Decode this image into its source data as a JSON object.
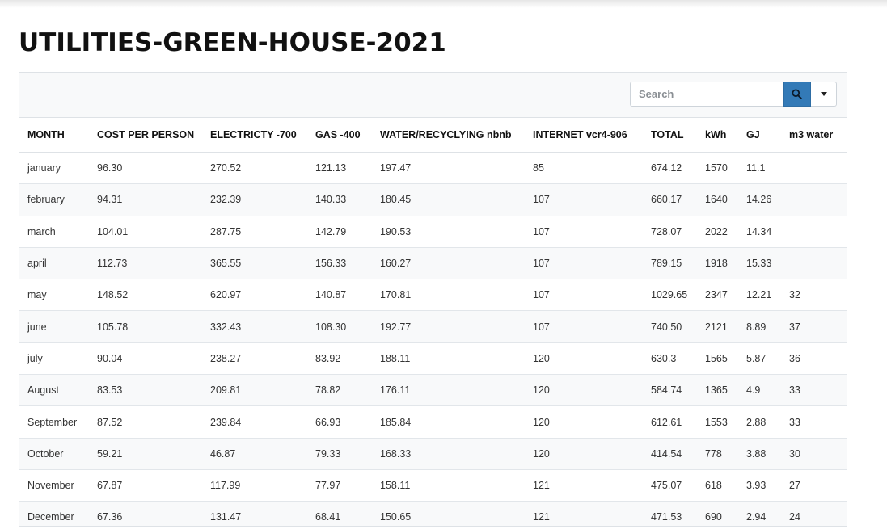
{
  "page": {
    "title": "UTILITIES-GREEN-HOUSE-2021"
  },
  "toolbar": {
    "search_placeholder": "Search"
  },
  "icons": {
    "search": "search-icon",
    "dropdown": "caret-down-icon"
  },
  "colors": {
    "search_button": "#337ab7",
    "row_stripe": "#f8f9fa",
    "border": "#dee2e6"
  },
  "table": {
    "headers": [
      "MONTH",
      "COST PER PERSON",
      "ELECTRICTY -700",
      "GAS -400",
      "WATER/RECYCLYING nbnb",
      "INTERNET vcr4-906",
      "TOTAL",
      "kWh",
      "GJ",
      "m3 water"
    ],
    "rows": [
      [
        "january",
        "96.30",
        "270.52",
        "121.13",
        "197.47",
        "85",
        "674.12",
        "1570",
        "11.1",
        ""
      ],
      [
        "february",
        "94.31",
        "232.39",
        "140.33",
        "180.45",
        "107",
        "660.17",
        "1640",
        "14.26",
        ""
      ],
      [
        "march",
        "104.01",
        "287.75",
        "142.79",
        "190.53",
        "107",
        "728.07",
        "2022",
        "14.34",
        ""
      ],
      [
        "april",
        "112.73",
        "365.55",
        "156.33",
        "160.27",
        "107",
        "789.15",
        "1918",
        "15.33",
        ""
      ],
      [
        "may",
        "148.52",
        "620.97",
        "140.87",
        "170.81",
        "107",
        "1029.65",
        "2347",
        "12.21",
        "32"
      ],
      [
        "june",
        "105.78",
        "332.43",
        "108.30",
        "192.77",
        "107",
        "740.50",
        "2121",
        "8.89",
        "37"
      ],
      [
        "july",
        "90.04",
        "238.27",
        "83.92",
        "188.11",
        "120",
        "630.3",
        "1565",
        "5.87",
        "36"
      ],
      [
        "August",
        "83.53",
        "209.81",
        "78.82",
        "176.11",
        "120",
        "584.74",
        "1365",
        "4.9",
        "33"
      ],
      [
        "September",
        "87.52",
        "239.84",
        "66.93",
        "185.84",
        "120",
        "612.61",
        "1553",
        "2.88",
        "33"
      ],
      [
        "October",
        "59.21",
        "46.87",
        "79.33",
        "168.33",
        "120",
        "414.54",
        "778",
        "3.88",
        "30"
      ],
      [
        "November",
        "67.87",
        "117.99",
        "77.97",
        "158.11",
        "121",
        "475.07",
        "618",
        "3.93",
        "27"
      ],
      [
        "December",
        "67.36",
        "131.47",
        "68.41",
        "150.65",
        "121",
        "471.53",
        "690",
        "2.94",
        "24"
      ]
    ]
  }
}
